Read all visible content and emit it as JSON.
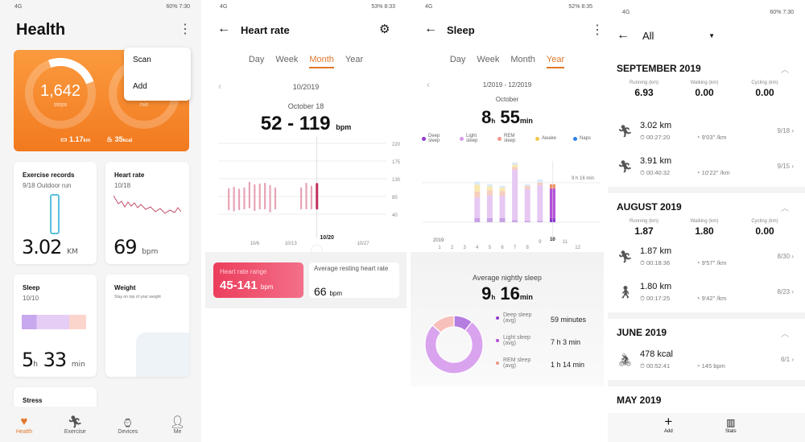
{
  "colors": {
    "accent": "#e0772b",
    "heart": "#e84a64",
    "deep": "#8e3ad0",
    "light": "#d79be8",
    "rem": "#f0958a",
    "awake": "#f2c94c",
    "naps": "#2f80ed"
  },
  "health": {
    "status": {
      "left": "4G",
      "right": "60% 7:30"
    },
    "title": "Health",
    "menu": [
      "Scan",
      "Add"
    ],
    "activity": {
      "steps": "1,642",
      "steps_label": "steps",
      "min_label": "min",
      "distance": "1.17",
      "distance_unit": "km",
      "calories": "35",
      "calories_unit": "kcal"
    },
    "exercise": {
      "title": "Exercise records",
      "sub": "9/18 Outdoor run",
      "value": "3.02",
      "unit": "KM"
    },
    "heart": {
      "title": "Heart rate",
      "sub": "10/18",
      "value": "69",
      "unit": "bpm"
    },
    "sleep": {
      "title": "Sleep",
      "sub": "10/10",
      "h": "5",
      "h_unit": "h",
      "m": "33",
      "m_unit": "min"
    },
    "weight": {
      "title": "Weight",
      "sub": "Stay on top of your weight"
    },
    "stress": {
      "title": "Stress"
    },
    "nav": [
      {
        "label": "Health",
        "icon": "heart-icon"
      },
      {
        "label": "Exercise",
        "icon": "run-icon"
      },
      {
        "label": "Devices",
        "icon": "watch-icon"
      },
      {
        "label": "Me",
        "icon": "person-icon"
      }
    ]
  },
  "heart_rate": {
    "status": {
      "left": "4G",
      "right": "53% 8:33"
    },
    "title": "Heart rate",
    "tabs": [
      "Day",
      "Week",
      "Month",
      "Year"
    ],
    "active_tab": "Month",
    "period": "10/2019",
    "date": "October 18",
    "range": "52 - 119",
    "unit": "bpm",
    "chart_data": {
      "type": "bar",
      "y_ticks": [
        "220",
        "175",
        "130",
        "85",
        "40"
      ],
      "ylim": [
        40,
        220
      ],
      "x_labels": [
        "10/6",
        "10/13",
        "10/20",
        "10/27"
      ],
      "days": [
        {
          "day": 1,
          "min": 50,
          "max": 106
        },
        {
          "day": 2,
          "min": 47,
          "max": 110
        },
        {
          "day": 3,
          "min": 50,
          "max": 105
        },
        {
          "day": 4,
          "min": 52,
          "max": 108
        },
        {
          "day": 5,
          "min": 55,
          "max": 122
        },
        {
          "day": 6,
          "min": 48,
          "max": 116
        },
        {
          "day": 7,
          "min": 52,
          "max": 118
        },
        {
          "day": 8,
          "min": 52,
          "max": 120
        },
        {
          "day": 9,
          "min": 44,
          "max": 114
        },
        {
          "day": 10,
          "min": 52,
          "max": 108
        },
        {
          "day": 15,
          "min": 52,
          "max": 108
        },
        {
          "day": 16,
          "min": 52,
          "max": 120
        },
        {
          "day": 17,
          "min": 52,
          "max": 112
        },
        {
          "day": 18,
          "min": 52,
          "max": 119
        }
      ],
      "selected_day": 18
    },
    "range_card": {
      "label": "Heart rate range",
      "value": "45-141",
      "unit": "bpm"
    },
    "resting_card": {
      "label": "Average resting heart rate",
      "value": "66",
      "unit": "bpm"
    }
  },
  "sleep": {
    "status": {
      "left": "4G",
      "right": "52% 8:35"
    },
    "title": "Sleep",
    "tabs": [
      "Day",
      "Week",
      "Month",
      "Year"
    ],
    "active_tab": "Year",
    "period": "1/2019 - 12/2019",
    "month": "October",
    "h": "8",
    "m": "55",
    "h_unit": "h",
    "m_unit": "min",
    "legend": [
      "Deep sleep",
      "Light sleep",
      "REM sleep",
      "Awake",
      "Naps"
    ],
    "chart_data": {
      "type": "bar",
      "stacked": true,
      "x_labels": [
        "1",
        "2",
        "3",
        "4",
        "5",
        "6",
        "7",
        "8",
        "9",
        "10",
        "11",
        "12"
      ],
      "year_label": "2019",
      "reference_label": "9 h 16 min",
      "reference": 9.27,
      "series": [
        {
          "name": "Deep sleep",
          "values": [
            0,
            0,
            0,
            1,
            1,
            1,
            0.5,
            0.3,
            0.3,
            1
          ]
        },
        {
          "name": "Light sleep",
          "values": [
            0,
            0,
            0,
            4.8,
            5.3,
            5.2,
            11.8,
            7.5,
            8.4,
            6.9
          ]
        },
        {
          "name": "REM sleep",
          "values": [
            0,
            0,
            0,
            1.4,
            1.2,
            1.1,
            0.6,
            0.7,
            0.6,
            1
          ]
        },
        {
          "name": "Awake",
          "values": [
            0,
            0,
            0,
            1.6,
            0.9,
            0.8,
            0.6,
            0,
            0,
            0
          ]
        },
        {
          "name": "Naps",
          "values": [
            0,
            0,
            0,
            0.7,
            0.5,
            0.4,
            0.5,
            0.4,
            0.7,
            0
          ]
        }
      ],
      "selected": "10"
    },
    "avg_label": "Average nightly sleep",
    "avg_h": "9",
    "avg_m": "16",
    "breakdown": [
      {
        "label": "Deep sleep (avg)",
        "value": "59 minutes",
        "minutes": 59
      },
      {
        "label": "Light sleep (avg)",
        "value": "7 h 3 min",
        "minutes": 423
      },
      {
        "label": "REM sleep (avg)",
        "value": "1 h 14 min",
        "minutes": 74
      }
    ]
  },
  "records": {
    "status": {
      "left": "4G",
      "right": "60% 7:30"
    },
    "filter": "All",
    "stat_labels": [
      "Running (km)",
      "Walking (km)",
      "Cycling (km)"
    ],
    "months": [
      {
        "title": "SEPTEMBER 2019",
        "stats": [
          "6.93",
          "0.00",
          "0.00"
        ],
        "items": [
          {
            "icon": "run-icon",
            "main": "3.02 km",
            "time": "00:27:20",
            "pace": "9'03\" /km",
            "date": "9/18"
          },
          {
            "icon": "run-icon",
            "main": "3.91 km",
            "time": "00:40:32",
            "pace": "10'22\" /km",
            "date": "9/15"
          }
        ]
      },
      {
        "title": "AUGUST 2019",
        "stats": [
          "1.87",
          "1.80",
          "0.00"
        ],
        "items": [
          {
            "icon": "run-icon",
            "main": "1.87 km",
            "time": "00:18:36",
            "pace": "9'57\" /km",
            "date": "8/30"
          },
          {
            "icon": "walk-icon",
            "main": "1.80 km",
            "time": "00:17:25",
            "pace": "9'42\" /km",
            "date": "8/23"
          }
        ]
      },
      {
        "title": "JUNE 2019",
        "items": [
          {
            "icon": "bike-icon",
            "main": "478 kcal",
            "time": "00:52:41",
            "pace": "145 bpm",
            "date": "6/1"
          }
        ]
      },
      {
        "title": "MAY 2019"
      }
    ],
    "bottom": [
      "Add",
      "Stats"
    ]
  }
}
